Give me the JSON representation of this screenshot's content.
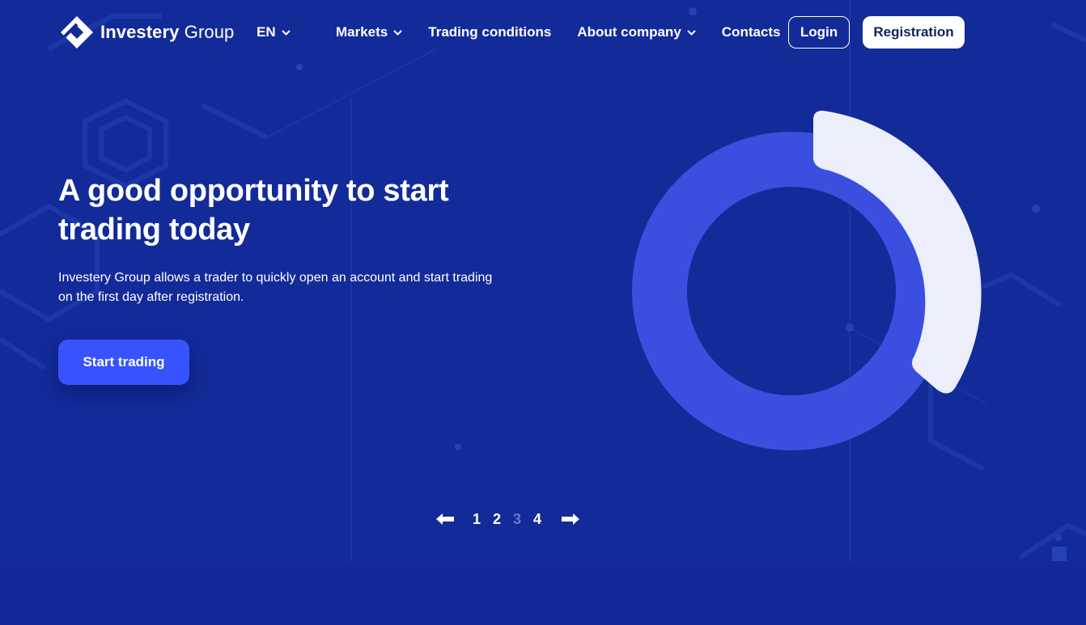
{
  "header": {
    "logo_bold": "Investery",
    "logo_light": "Group",
    "language": "EN",
    "nav": [
      {
        "label": "Markets",
        "dropdown": true
      },
      {
        "label": "Trading conditions",
        "dropdown": false
      },
      {
        "label": "About company",
        "dropdown": true
      },
      {
        "label": "Contacts",
        "dropdown": false
      }
    ],
    "login_label": "Login",
    "register_label": "Registration"
  },
  "hero": {
    "title": "A good opportunity to start trading today",
    "description": "Investery Group allows a trader to quickly open an account and start trading on the first day after registration.",
    "cta_label": "Start trading"
  },
  "slider": {
    "pages": [
      "1",
      "2",
      "3",
      "4"
    ],
    "active_page": "3",
    "prev_icon": "arrow-left-icon",
    "next_icon": "arrow-right-icon"
  },
  "colors": {
    "background": "#132b99",
    "accent": "#3653ff",
    "donut_ring": "#3a4fe0",
    "donut_highlight": "#eceefb",
    "inactive_page": "#6a78c6"
  },
  "donut": {
    "highlight_fraction": 0.3
  }
}
